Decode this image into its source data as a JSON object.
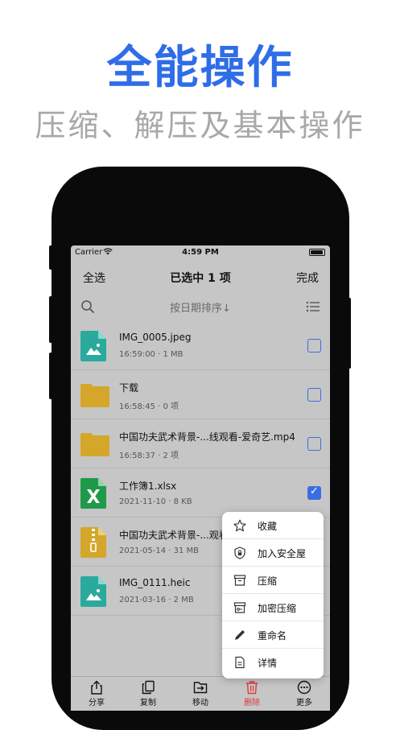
{
  "promo": {
    "title": "全能操作",
    "subtitle": "压缩、解压及基本操作"
  },
  "statusbar": {
    "carrier": "Carrier",
    "time": "4:59 PM"
  },
  "navbar": {
    "select_all": "全选",
    "title": "已选中 1 项",
    "done": "完成"
  },
  "toolbar": {
    "sort_label": "按日期排序↓"
  },
  "files": [
    {
      "name": "IMG_0005.jpeg",
      "meta": "16:59:00 · 1 MB",
      "icon": "image-file-icon",
      "checked": false
    },
    {
      "name": "下载",
      "meta": "16:58:45 · 0 项",
      "icon": "folder-icon",
      "checked": false
    },
    {
      "name": "中国功夫武术背景-...线观看-爱奇艺.mp4",
      "meta": "16:58:37 · 2 项",
      "icon": "folder-icon",
      "checked": false
    },
    {
      "name": "工作簿1.xlsx",
      "meta": "2021-11-10 · 8 KB",
      "icon": "excel-file-icon",
      "checked": true
    },
    {
      "name": "中国功夫武术背景-...观看",
      "meta": "2021-05-14 · 31 MB",
      "icon": "zip-file-icon",
      "checked": false
    },
    {
      "name": "IMG_0111.heic",
      "meta": "2021-03-16 · 2 MB",
      "icon": "image-file-icon",
      "checked": false
    }
  ],
  "menu": {
    "items": [
      {
        "label": "收藏",
        "icon": "star-icon"
      },
      {
        "label": "加入安全屋",
        "icon": "shield-lock-icon"
      },
      {
        "label": "压缩",
        "icon": "archive-box-icon"
      },
      {
        "label": "加密压缩",
        "icon": "encrypted-archive-icon"
      },
      {
        "label": "重命名",
        "icon": "pencil-icon"
      },
      {
        "label": "详情",
        "icon": "document-icon"
      }
    ]
  },
  "tabbar": {
    "items": [
      {
        "label": "分享",
        "icon": "share-icon"
      },
      {
        "label": "复制",
        "icon": "copy-icon"
      },
      {
        "label": "移动",
        "icon": "move-icon"
      },
      {
        "label": "删除",
        "icon": "trash-icon"
      },
      {
        "label": "更多",
        "icon": "more-icon"
      }
    ]
  },
  "colors": {
    "accent": "#2f6de8",
    "checkbox": "#3a6ee0",
    "danger": "#e03a3a",
    "folder": "#d4a72a",
    "image_file": "#2aaa9c",
    "excel_file": "#1f9a4a"
  }
}
